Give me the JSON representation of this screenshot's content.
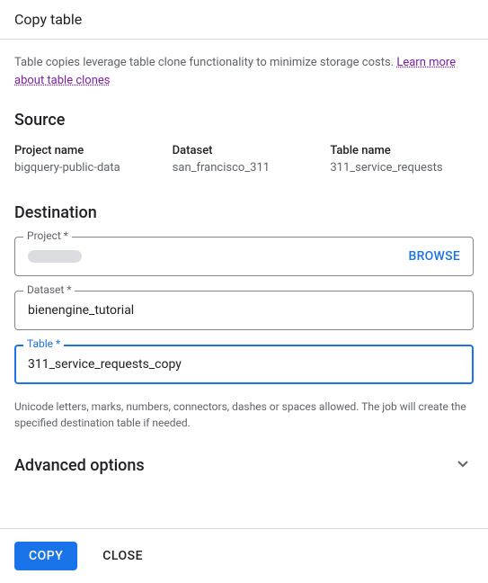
{
  "header": {
    "title": "Copy table"
  },
  "info": {
    "text_before_link": "Table copies leverage table clone functionality to minimize storage costs. ",
    "link_text": "Learn more about table clones"
  },
  "source": {
    "heading": "Source",
    "project_label": "Project name",
    "project_value": "bigquery-public-data",
    "dataset_label": "Dataset",
    "dataset_value": "san_francisco_311",
    "table_label": "Table name",
    "table_value": "311_service_requests"
  },
  "destination": {
    "heading": "Destination",
    "project_label": "Project *",
    "browse_label": "BROWSE",
    "dataset_label": "Dataset *",
    "dataset_value": "bienengine_tutorial",
    "table_label": "Table *",
    "table_value": "311_service_requests_copy",
    "table_helper": "Unicode letters, marks, numbers, connectors, dashes or spaces allowed. The job will create the specified destination table if needed."
  },
  "advanced": {
    "label": "Advanced options"
  },
  "footer": {
    "copy_label": "COPY",
    "close_label": "CLOSE"
  }
}
